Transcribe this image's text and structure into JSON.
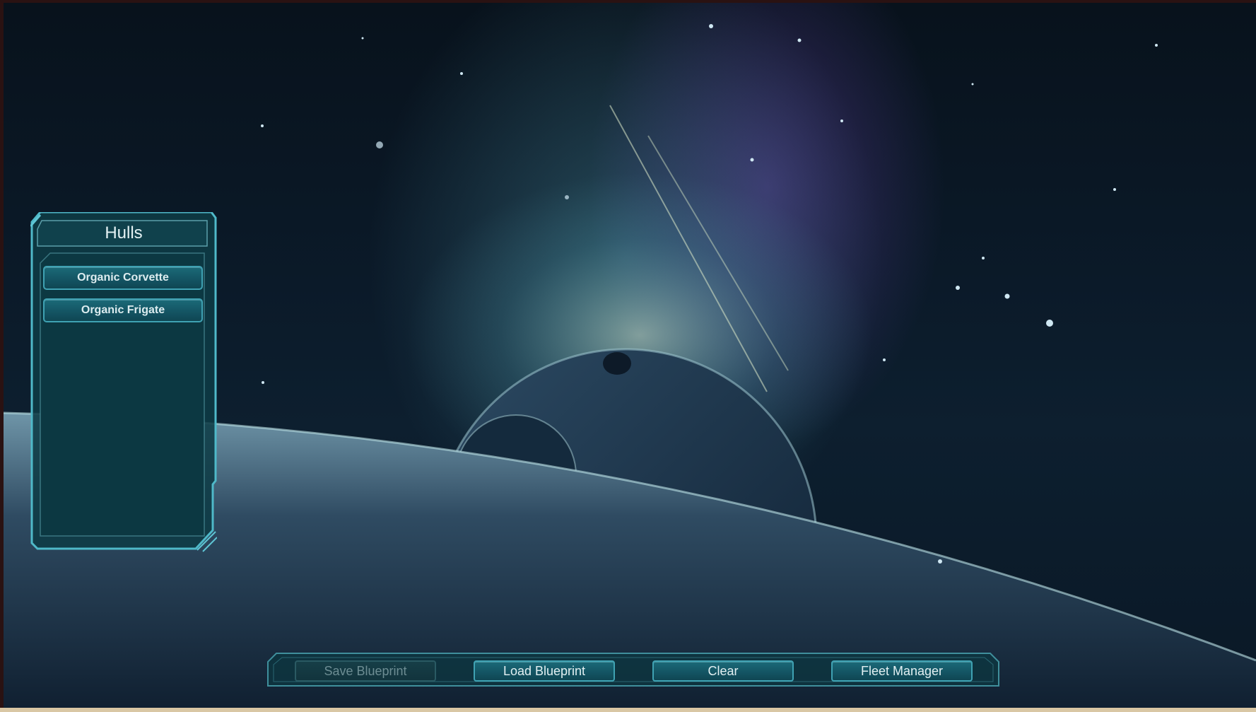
{
  "hulls_panel": {
    "title": "Hulls",
    "items": [
      {
        "label": "Organic Corvette"
      },
      {
        "label": "Organic Frigate"
      }
    ]
  },
  "toolbar": {
    "save_blueprint": {
      "label": "Save Blueprint",
      "enabled": false
    },
    "load_blueprint": {
      "label": "Load Blueprint",
      "enabled": true
    },
    "clear": {
      "label": "Clear",
      "enabled": true
    },
    "fleet_manager": {
      "label": "Fleet Manager",
      "enabled": true
    }
  },
  "colors": {
    "accent": "#3fa2b3",
    "button_fill": "#145564",
    "panel_fill": "#0d3a44",
    "text": "#e2f0f2"
  }
}
